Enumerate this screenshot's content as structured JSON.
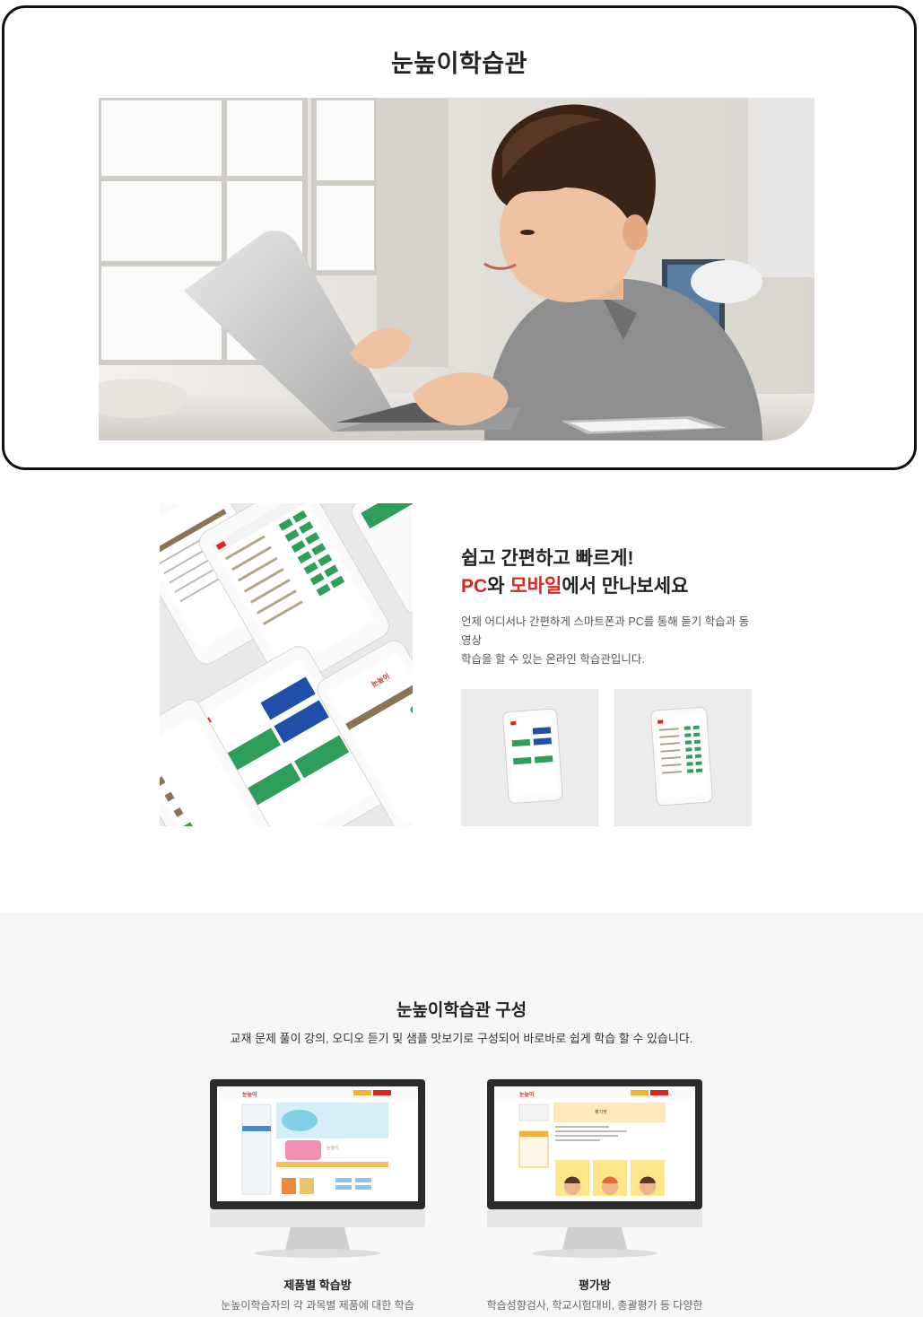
{
  "hero": {
    "title": "눈높이학습관"
  },
  "intro": {
    "tagline_line1": "쉽고 간편하고 빠르게!",
    "tagline_highlight_pc": "PC",
    "tagline_connector": "와 ",
    "tagline_highlight_mobile": "모바일",
    "tagline_rest": "에서 만나보세요",
    "description_line1": "언제 어디서나 간편하게 스마트폰과 PC를 통해 듣기 학습과 동영상",
    "description_line2": "학습을 할 수 있는 온라인 학습관입니다.",
    "device_brand": "눈높이"
  },
  "composition": {
    "title": "눈높이학습관 구성",
    "subtitle": "교재 문제 풀이 강의, 오디오 듣기 및 샘플 맛보기로 구성되어 바로바로 쉽게 학습 할 수 있습니다.",
    "cards": [
      {
        "label": "제품별 학습방",
        "description": "눈높이학습자의 각 과목별 제품에 대한 학습",
        "screen_brand": "눈높이"
      },
      {
        "label": "평가방",
        "description": "학습성향검사, 학교시험대비, 총괄평가 등 다양한",
        "screen_brand": "눈높이"
      }
    ]
  },
  "colors": {
    "accent_red": "#e2231a",
    "app_green": "#2e9e5b",
    "app_blue": "#1f4fa8",
    "app_brown": "#8a7454",
    "section_gray": "#f7f7f7"
  }
}
